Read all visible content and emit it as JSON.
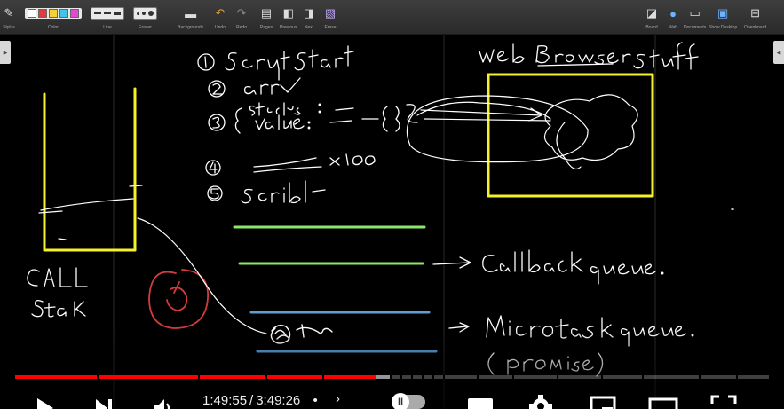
{
  "toolbar": {
    "groups": [
      {
        "id": "stylus",
        "label": "Stylus"
      },
      {
        "id": "color",
        "label": "Color"
      },
      {
        "id": "line",
        "label": "Line"
      },
      {
        "id": "eraser",
        "label": "Eraser"
      },
      {
        "id": "backgrounds",
        "label": "Backgrounds"
      },
      {
        "id": "undo",
        "label": "Undo"
      },
      {
        "id": "redo",
        "label": "Redo"
      },
      {
        "id": "pages",
        "label": "Pages"
      },
      {
        "id": "previous",
        "label": "Previous"
      },
      {
        "id": "next",
        "label": "Next"
      },
      {
        "id": "erase",
        "label": "Erase"
      },
      {
        "id": "board",
        "label": "Board"
      },
      {
        "id": "web",
        "label": "Web"
      },
      {
        "id": "documents",
        "label": "Documents"
      },
      {
        "id": "show_desktop",
        "label": "Show Desktop"
      },
      {
        "id": "openboard",
        "label": "Openboard"
      }
    ],
    "colors": [
      "#ffffff",
      "#e23b3b",
      "#f2d23a",
      "#45c2e6",
      "#e24ad2"
    ]
  },
  "board": {
    "strokes": [
      "① script start",
      "② arr",
      "③ { status: value: } —{}—",
      "④ x 100",
      "⑤ scribl —",
      "Web Browser stuff",
      "CALL Stack",
      "then",
      "→ Callback queue.",
      "→ Microtask queue.",
      "(promise)"
    ],
    "colors": {
      "yellow": "#f6f22a",
      "green": "#8be86d",
      "blue": "#5f9fd6",
      "red": "#d63a3a",
      "ink": "#ffffff"
    }
  },
  "player": {
    "current_time": "1:49:55",
    "separator": "/",
    "duration": "3:49:26",
    "progress_fraction": 0.479,
    "chapter_chevron": "›",
    "autoplay_on": true,
    "autoplay_glyph": "II",
    "icons": [
      "play-icon",
      "next-icon",
      "volume-icon",
      "subtitles-icon",
      "settings-icon",
      "miniplayer-icon",
      "theater-icon",
      "fullscreen-icon"
    ]
  }
}
